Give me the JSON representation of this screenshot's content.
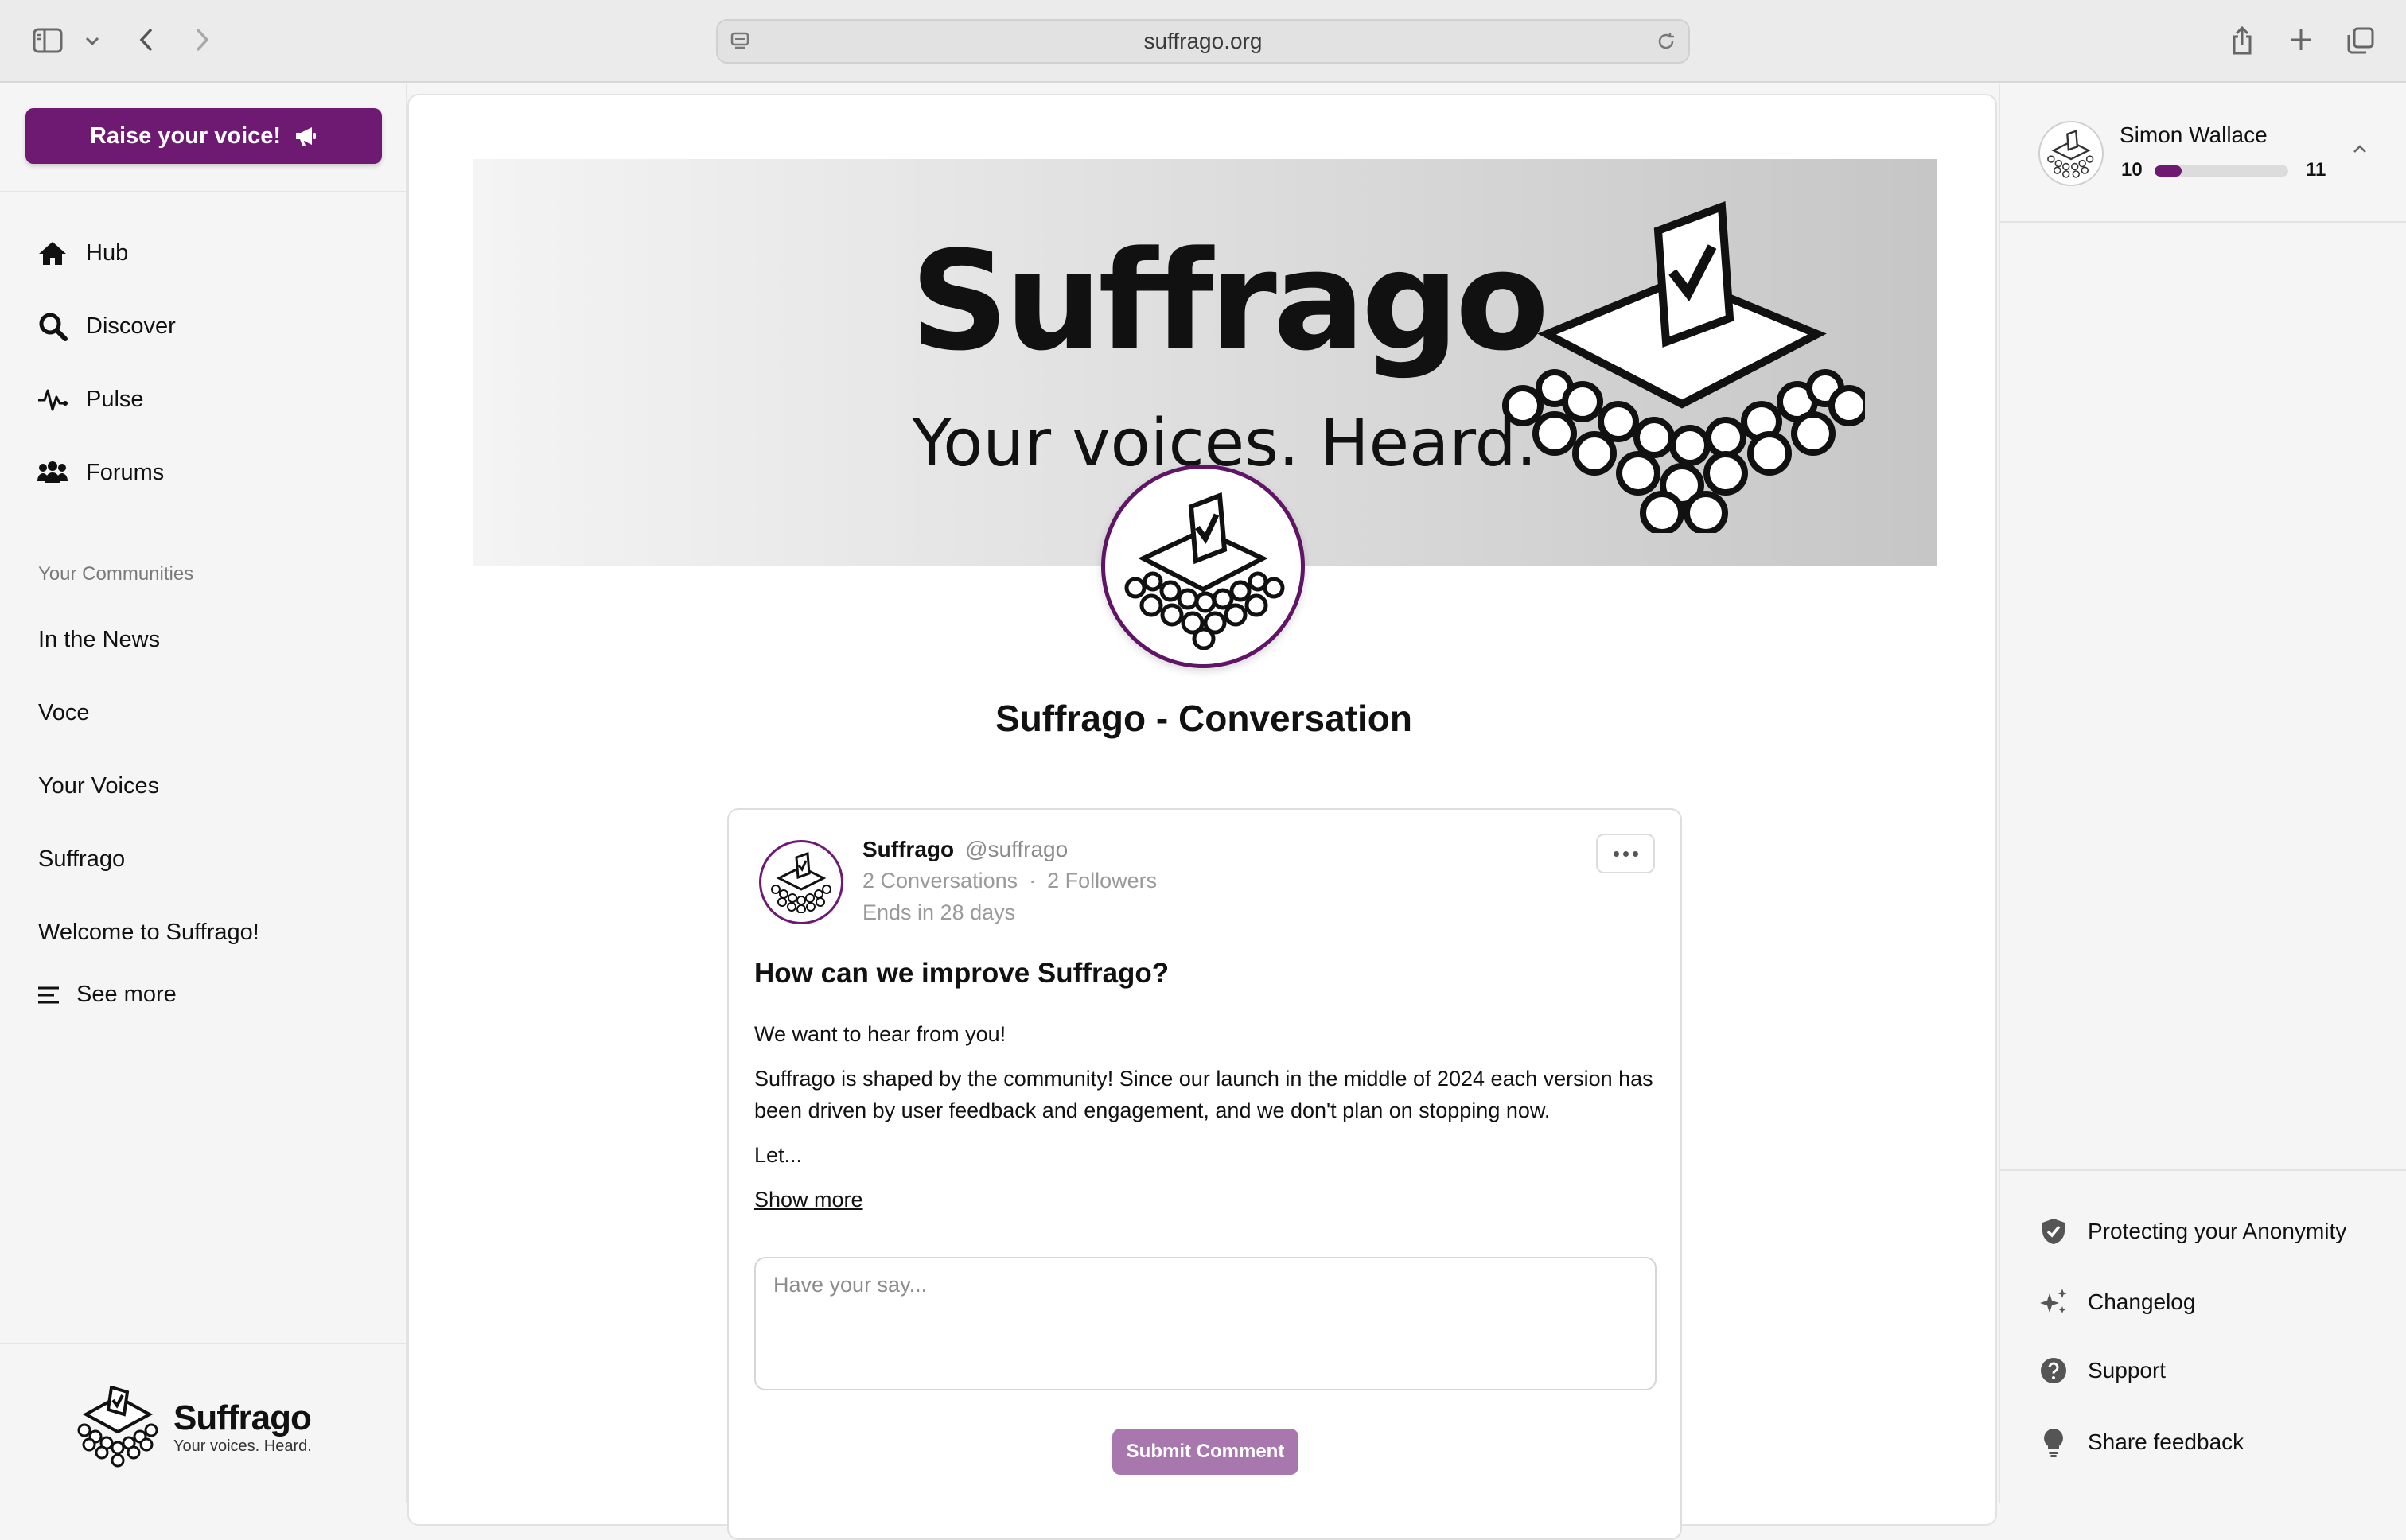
{
  "browser": {
    "url": "suffrago.org"
  },
  "sidebar": {
    "cta_label": "Raise your voice!",
    "nav": [
      {
        "label": "Hub",
        "icon": "home-icon"
      },
      {
        "label": "Discover",
        "icon": "search-icon"
      },
      {
        "label": "Pulse",
        "icon": "pulse-icon"
      },
      {
        "label": "Forums",
        "icon": "users-icon"
      }
    ],
    "communities_title": "Your Communities",
    "communities": [
      "In the News",
      "Voce",
      "Your Voices",
      "Suffrago",
      "Welcome to Suffrago!"
    ],
    "see_more": "See more",
    "logo_name": "Suffrago",
    "logo_tagline": "Your voices. Heard."
  },
  "banner": {
    "title": "Suffrago",
    "subtitle": "Your voices. Heard."
  },
  "page": {
    "title": "Suffrago - Conversation"
  },
  "post": {
    "author_name": "Suffrago",
    "author_handle": "@suffrago",
    "conversations": "2 Conversations",
    "separator": "·",
    "followers": "2 Followers",
    "ends": "Ends in 28 days",
    "title": "How can we improve Suffrago?",
    "paragraphs": [
      "We want to hear from you!",
      "Suffrago is shaped by the community! Since our launch in the middle of 2024 each version has been driven by user feedback and engagement, and we don't plan on stopping now.",
      "Let..."
    ],
    "show_more": "Show more",
    "comment_placeholder": "Have your say...",
    "submit_label": "Submit Comment"
  },
  "user": {
    "name": "Simon Wallace",
    "level_current": "10",
    "level_next": "11",
    "progress": 0.2
  },
  "right_links": [
    {
      "label": "Protecting your Anonymity",
      "icon": "shield-check-icon"
    },
    {
      "label": "Changelog",
      "icon": "sparkles-icon"
    },
    {
      "label": "Support",
      "icon": "question-circle-icon"
    },
    {
      "label": "Share feedback",
      "icon": "lightbulb-icon"
    }
  ],
  "colors": {
    "brand": "#6e1a72",
    "submit_disabled": "#a877ad"
  }
}
